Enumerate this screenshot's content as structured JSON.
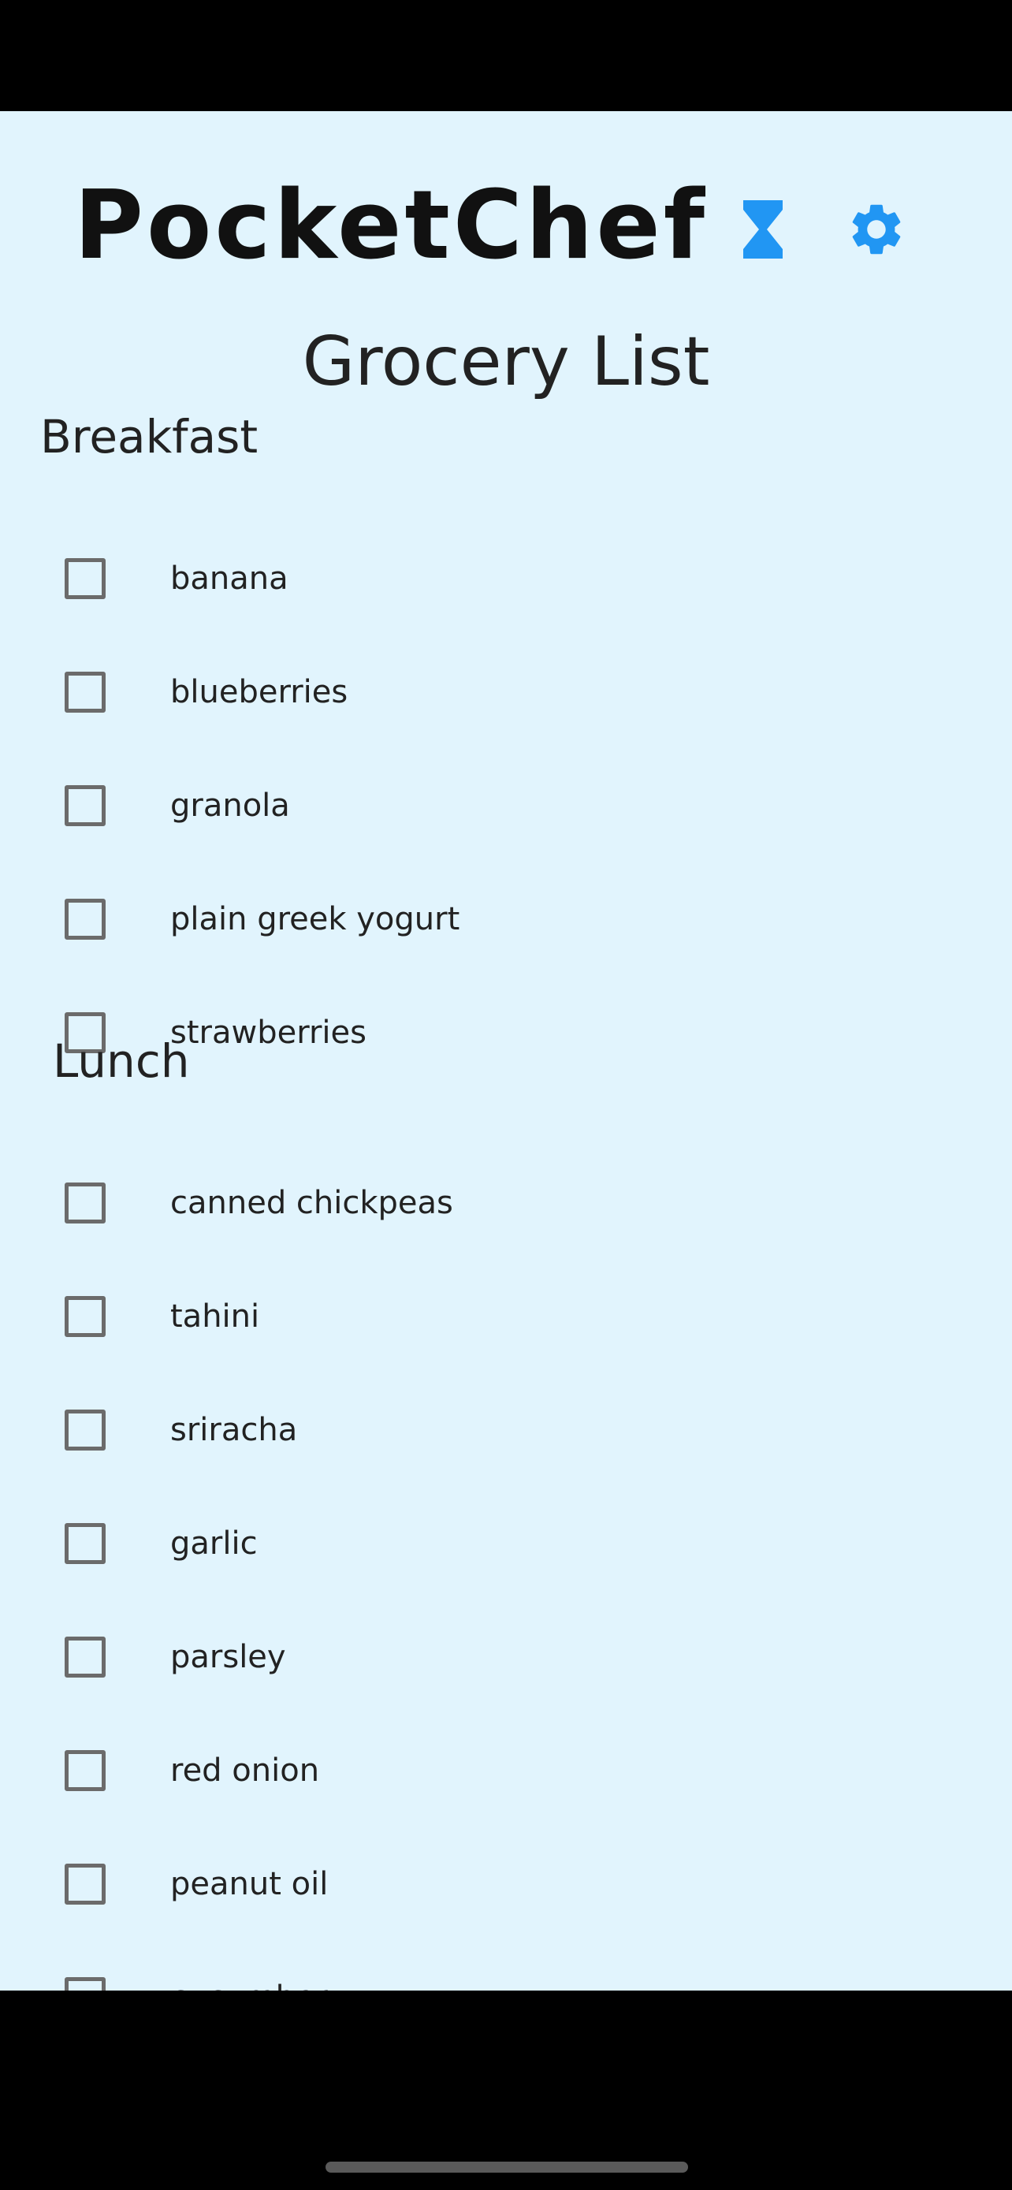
{
  "app": {
    "title": "PocketChef",
    "accent_color": "#2196f3",
    "background_color": "#e1f4fd"
  },
  "header": {
    "timer_icon": "hourglass-icon",
    "settings_icon": "gear-icon"
  },
  "page": {
    "title": "Grocery List"
  },
  "sections": [
    {
      "title": "Breakfast",
      "items": [
        {
          "label": "banana",
          "checked": false
        },
        {
          "label": "blueberries",
          "checked": false
        },
        {
          "label": "granola",
          "checked": false
        },
        {
          "label": "plain greek yogurt",
          "checked": false
        },
        {
          "label": "strawberries",
          "checked": false
        }
      ]
    },
    {
      "title": "Lunch",
      "items": [
        {
          "label": "canned chickpeas",
          "checked": false
        },
        {
          "label": "tahini",
          "checked": false
        },
        {
          "label": "sriracha",
          "checked": false
        },
        {
          "label": "garlic",
          "checked": false
        },
        {
          "label": "parsley",
          "checked": false
        },
        {
          "label": "red onion",
          "checked": false
        },
        {
          "label": "peanut oil",
          "checked": false
        },
        {
          "label": "cucumber",
          "checked": false
        }
      ]
    }
  ],
  "bottom_nav": {
    "background_color": "#b3e3fb",
    "items": [
      {
        "icon": "person-icon",
        "active": false
      },
      {
        "icon": "meals-icon",
        "active": false
      },
      {
        "icon": "cart-icon",
        "active": true,
        "color": "#f44336"
      }
    ]
  }
}
